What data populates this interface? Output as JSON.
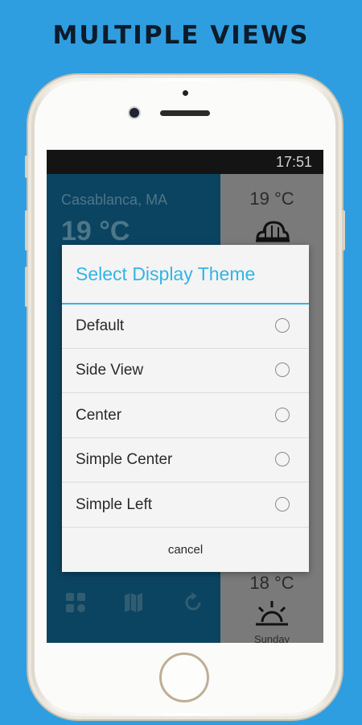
{
  "headline": "MULTIPLE VIEWS",
  "status_bar": {
    "time": "17:51"
  },
  "weather_background": {
    "city": "Casablanca, MA",
    "main_temp": "19 °C",
    "top_forecast_temp": "19 °C",
    "top_forecast_icon": "cloud-rain-icon",
    "bottom_forecast_temp": "18 °C",
    "bottom_forecast_icon": "sunrise-icon",
    "bottom_forecast_day": "Sunday",
    "bottom_nav_icons": [
      "grid-icon",
      "map-icon",
      "refresh-icon"
    ]
  },
  "dialog": {
    "title": "Select Display Theme",
    "options": [
      {
        "label": "Default",
        "selected": false
      },
      {
        "label": "Side View",
        "selected": false
      },
      {
        "label": "Center",
        "selected": false
      },
      {
        "label": "Simple Center",
        "selected": false
      },
      {
        "label": "Simple Left",
        "selected": false
      }
    ],
    "cancel_label": "cancel",
    "accent_color": "#33b5e5"
  },
  "colors": {
    "background": "#2f9ee0",
    "left_panel": "#0b4461",
    "right_panel": "#7a7a7a"
  }
}
